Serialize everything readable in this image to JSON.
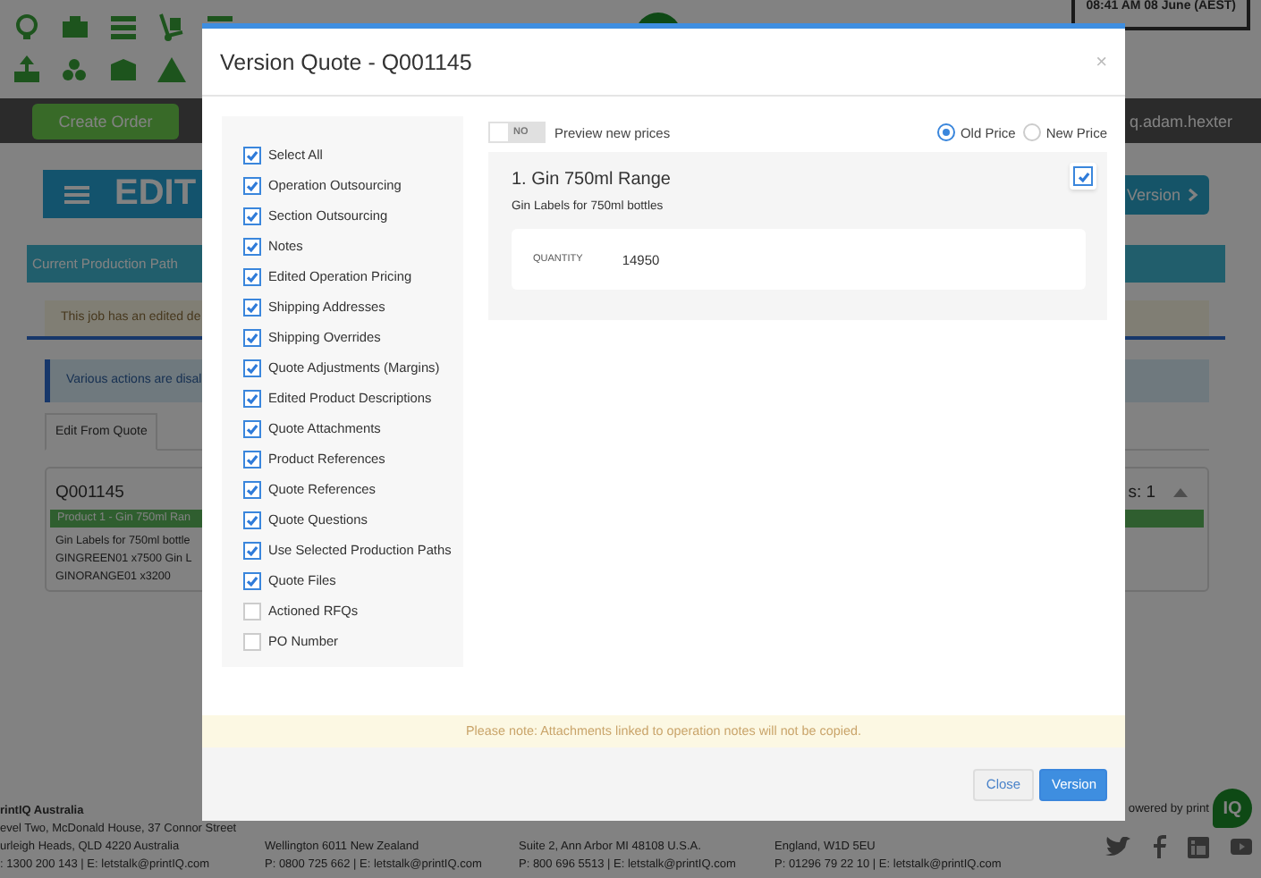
{
  "header": {
    "clock": "08:41 AM 08 June (AEST)"
  },
  "nav": {
    "create_button": "Create Order",
    "user": "q.adam.hexter"
  },
  "page": {
    "title": "EDIT",
    "version_button": "Version",
    "path_bar": "Current Production Path",
    "alert": "This job has an edited de",
    "info": "Various actions are disal",
    "tabs": [
      {
        "label": "Edit From Quote",
        "selected": true
      }
    ],
    "quote_card": {
      "title": "Q001145",
      "count": "s: 1",
      "product_bar": "Product 1 - Gin 750ml Ran",
      "lines": [
        "Gin Labels for 750ml bottle",
        "GINGREEN01 x7500 Gin L",
        "GINORANGE01 x3200"
      ]
    }
  },
  "modal": {
    "title": "Version Quote - Q001145",
    "close": "×",
    "options": [
      {
        "label": "Select All",
        "checked": true
      },
      {
        "label": "Operation Outsourcing",
        "checked": true
      },
      {
        "label": "Section Outsourcing",
        "checked": true
      },
      {
        "label": "Notes",
        "checked": true
      },
      {
        "label": "Edited Operation Pricing",
        "checked": true
      },
      {
        "label": "Shipping Addresses",
        "checked": true
      },
      {
        "label": "Shipping Overrides",
        "checked": true
      },
      {
        "label": "Quote Adjustments (Margins)",
        "checked": true
      },
      {
        "label": "Edited Product Descriptions",
        "checked": true
      },
      {
        "label": "Quote Attachments",
        "checked": true
      },
      {
        "label": "Product References",
        "checked": true
      },
      {
        "label": "Quote References",
        "checked": true
      },
      {
        "label": "Quote Questions",
        "checked": true
      },
      {
        "label": "Use Selected Production Paths",
        "checked": true
      },
      {
        "label": "Quote Files",
        "checked": true
      },
      {
        "label": "Actioned RFQs",
        "checked": false
      },
      {
        "label": "PO Number",
        "checked": false
      }
    ],
    "preview": {
      "label": "Preview new prices",
      "on": false,
      "switch_text": "NO"
    },
    "price_options": [
      {
        "label": "Old Price",
        "selected": true
      },
      {
        "label": "New Price",
        "selected": false
      }
    ],
    "products": [
      {
        "title": "1. Gin 750ml Range",
        "checked": true,
        "description": "Gin Labels for 750ml bottles",
        "fields": [
          {
            "label": "QUANTITY",
            "value": "14950"
          }
        ]
      }
    ],
    "notice": "Please note: Attachments linked to operation notes will not be copied.",
    "buttons": [
      {
        "label": "Close",
        "kind": "secondary"
      },
      {
        "label": "Version",
        "kind": "primary"
      }
    ]
  },
  "footer": {
    "columns": [
      {
        "lines": [
          "rintIQ Australia",
          "evel Two, McDonald House, 37 Connor Street",
          "urleigh Heads, QLD 4220 Australia",
          ": 1300 200 143 | E: letstalk@printIQ.com"
        ]
      },
      {
        "lines": [
          "Wellington 6011 New Zealand",
          "P: 0800 725 662 | E: letstalk@printIQ.com"
        ]
      },
      {
        "lines": [
          "Suite 2, Ann Arbor MI 48108 U.S.A.",
          "P: 800 696 5513 | E: letstalk@printIQ.com"
        ]
      },
      {
        "lines": [
          "England, W1D 5EU",
          "P: 01296 79 22 10 | E: letstalk@printIQ.com"
        ]
      }
    ],
    "powered": "owered by print",
    "logo": "IQ"
  }
}
